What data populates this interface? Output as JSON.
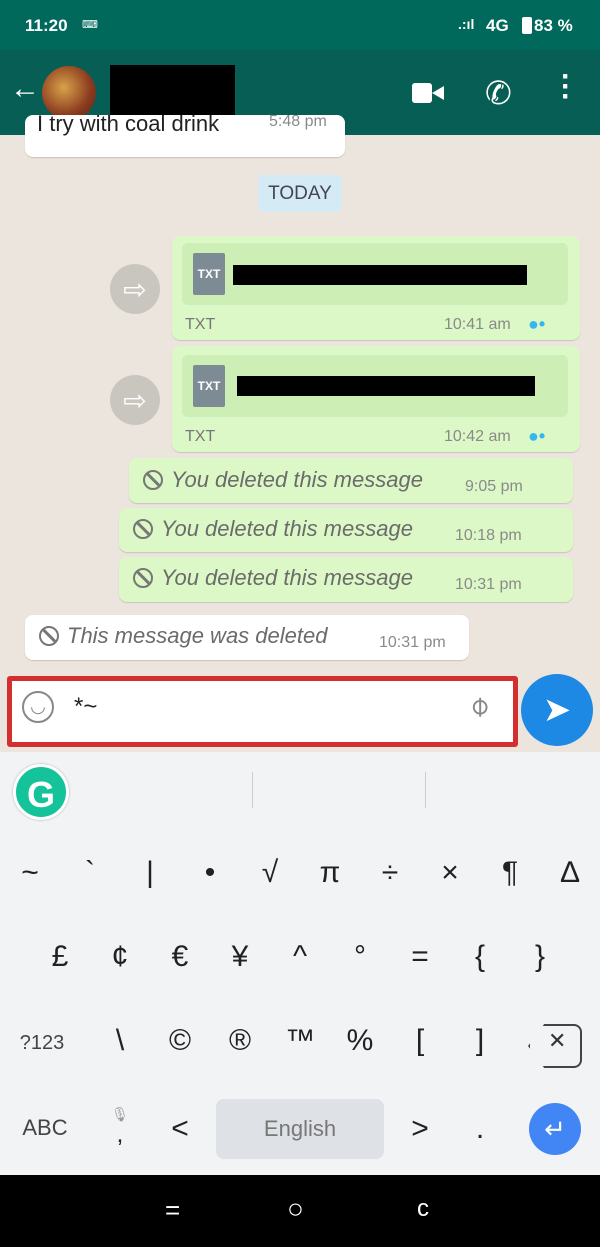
{
  "status_bar": {
    "time": "11:20",
    "network": "4G",
    "battery": "83 %"
  },
  "header": {
    "icons": [
      "back-arrow-icon",
      "avatar",
      "video-call-icon",
      "phone-icon",
      "more-vert-icon"
    ]
  },
  "chat": {
    "partial_message": {
      "text": "I try with coal drink",
      "time": "5:48 pm"
    },
    "date_pill": "TODAY",
    "file_messages": [
      {
        "file_type": "TXT",
        "label": "TXT",
        "time": "10:41 am"
      },
      {
        "file_type": "TXT",
        "label": "TXT",
        "time": "10:42 am"
      }
    ],
    "deleted_outgoing": [
      {
        "text": "You deleted this message",
        "time": "9:05 pm"
      },
      {
        "text": "You deleted this message",
        "time": "10:18 pm"
      },
      {
        "text": "You deleted this message",
        "time": "10:31 pm"
      }
    ],
    "deleted_incoming": {
      "text": "This message was deleted",
      "time": "10:31 pm"
    }
  },
  "composer": {
    "value": "*~",
    "highlight_color": "#d32f2f",
    "send_color": "#1e88e5"
  },
  "keyboard": {
    "row1": [
      "~",
      "`",
      "|",
      "•",
      "√",
      "π",
      "÷",
      "×",
      "¶",
      "∆"
    ],
    "row2": [
      "£",
      "¢",
      "€",
      "¥",
      "^",
      "°",
      "=",
      "{",
      "}"
    ],
    "row3": [
      "?123",
      "\\",
      "©",
      "®",
      "™",
      "%",
      "[",
      "]"
    ],
    "row4": {
      "abc": "ABC",
      "comma": ",",
      "lt": "<",
      "space": "English",
      "gt": ">",
      "period": "."
    }
  },
  "nav_bar": {
    "back": "c",
    "home": "○",
    "recents": "="
  }
}
